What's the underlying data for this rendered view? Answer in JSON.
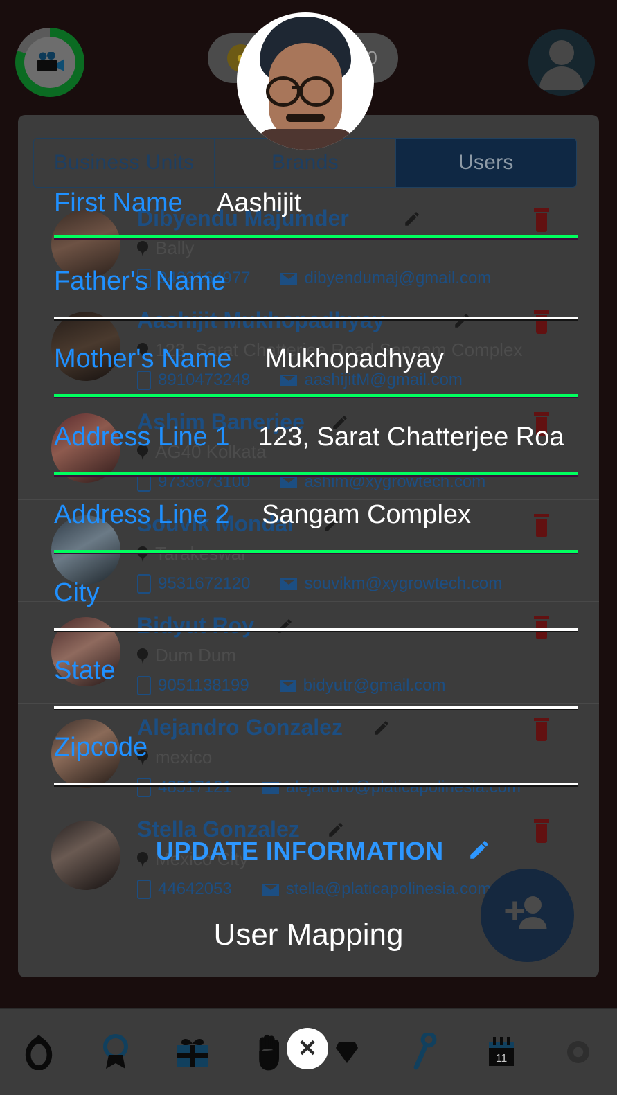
{
  "topbar": {
    "record_icon": "video-camera-icon",
    "record_progress": "75",
    "coin_icon": "coin-icon",
    "coin_value": "50",
    "profile_icon": "profile-avatar-icon"
  },
  "tabs": [
    {
      "label": "Business Units",
      "active": false
    },
    {
      "label": "Brands",
      "active": false
    },
    {
      "label": "Users",
      "active": true
    }
  ],
  "form": {
    "title": "UPDATE INFORMATION",
    "fields": [
      {
        "label": "First Name",
        "value": "Aashijit",
        "filled": true
      },
      {
        "label": "Father's Name",
        "value": "",
        "filled": false
      },
      {
        "label": "Mother's Name",
        "value": "Mukhopadhyay",
        "filled": true
      },
      {
        "label": "Address Line 1",
        "value": "123, Sarat Chatterjee Roa",
        "filled": true
      },
      {
        "label": "Address Line 2",
        "value": "Sangam Complex",
        "filled": true
      },
      {
        "label": "City",
        "value": "",
        "filled": false
      },
      {
        "label": "State",
        "value": "",
        "filled": false
      },
      {
        "label": "Zipcode",
        "value": "",
        "filled": false
      }
    ],
    "update_label": "UPDATE INFORMATION",
    "edit_icon": "pencil-icon",
    "user_mapping_label": "User Mapping",
    "fab_icon": "add-user-icon"
  },
  "users": [
    {
      "name": "Dibyendu Majumder",
      "location": "Bally",
      "phone": "9433164977",
      "email": "dibyendumaj@gmail.com"
    },
    {
      "name": "Aashijit Mukhopadhyay",
      "location": "123, Sarat Chatterjee Road Sangam Complex",
      "phone": "8910473248",
      "email": "aashijitM@gmail.com"
    },
    {
      "name": "Ashim Banerjee",
      "location": "AG40 Kolkata",
      "phone": "9733673100",
      "email": "ashim@xygrowtech.com"
    },
    {
      "name": "Souvik Mondal",
      "location": "Tarakeswar",
      "phone": "9531672120",
      "email": "souvikm@xygrowtech.com"
    },
    {
      "name": "Bidyut Roy",
      "location": "Dum Dum",
      "phone": "9051138199",
      "email": "bidyutr@gmail.com"
    },
    {
      "name": "Alejandro Gonzalez",
      "location": "mexico",
      "phone": "48517121",
      "email": "alejandro@platicapolinesia.com"
    },
    {
      "name": "Stella Gonzalez",
      "location": "Mexico City",
      "phone": "44642053",
      "email": "stella@platicapolinesia.com"
    }
  ],
  "bottom_nav": [
    {
      "icon": "ring-icon"
    },
    {
      "icon": "badge-award-icon"
    },
    {
      "icon": "gift-icon"
    },
    {
      "icon": "hand-icon"
    },
    {
      "icon": "diamond-icon"
    },
    {
      "icon": "key-icon"
    },
    {
      "icon": "calendar-icon"
    },
    {
      "icon": "gear-icon"
    }
  ],
  "close_button": {
    "label": "✕"
  },
  "colors": {
    "accent_blue": "#1f90ff",
    "link_blue": "#1c4e82",
    "filled_bar": "#00ff5e",
    "empty_bar": "#ffffff",
    "panel_bg": "#3c3c3c",
    "page_bg": "#190d0d",
    "active_tab": "#0f2844",
    "fab_bg": "#15283f",
    "trash_red": "#621111",
    "progress_green": "#0b6b22"
  }
}
